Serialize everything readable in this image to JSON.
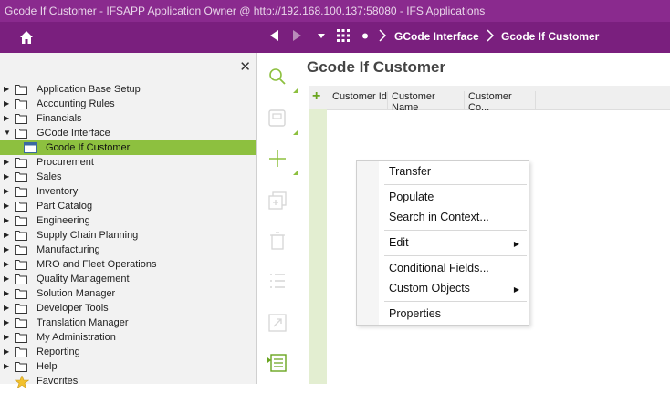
{
  "title_bar": {
    "text": "Gcode If Customer - IFSAPP Application Owner @ http://192.168.100.137:58080 - IFS Applications"
  },
  "nav": {
    "home_icon": "home-icon",
    "back_icon": "back-arrow-icon",
    "forward_icon": "forward-arrow-icon",
    "dropdown_icon": "chevron-down-icon",
    "apps_icon": "grid-icon",
    "dot_icon": "dot-icon",
    "breadcrumb": [
      "GCode Interface",
      "Gcode If Customer"
    ]
  },
  "sidebar": {
    "close_icon": "close-icon",
    "items": [
      {
        "label": "Application Base Setup"
      },
      {
        "label": "Accounting Rules"
      },
      {
        "label": "Financials"
      },
      {
        "label": "GCode Interface"
      },
      {
        "label": "Gcode If Customer"
      },
      {
        "label": "Procurement"
      },
      {
        "label": "Sales"
      },
      {
        "label": "Inventory"
      },
      {
        "label": "Part Catalog"
      },
      {
        "label": "Engineering"
      },
      {
        "label": "Supply Chain Planning"
      },
      {
        "label": "Manufacturing"
      },
      {
        "label": "MRO and Fleet Operations"
      },
      {
        "label": "Quality Management"
      },
      {
        "label": "Solution Manager"
      },
      {
        "label": "Developer Tools"
      },
      {
        "label": "Translation Manager"
      },
      {
        "label": "My Administration"
      },
      {
        "label": "Reporting"
      },
      {
        "label": "Help"
      },
      {
        "label": "Favorites"
      }
    ]
  },
  "toolbar": {
    "icons": [
      "search-icon",
      "save-icon",
      "add-icon",
      "duplicate-icon",
      "delete-icon",
      "list-icon",
      "open-icon",
      "details-icon"
    ]
  },
  "main": {
    "title": "Gcode If Customer",
    "columns": [
      "Customer Id",
      "Customer Name",
      "Customer Co..."
    ]
  },
  "context_menu": {
    "items": {
      "transfer": "Transfer",
      "populate": "Populate",
      "search_in_context": "Search in Context...",
      "edit": "Edit",
      "conditional_fields": "Conditional Fields...",
      "custom_objects": "Custom Objects",
      "properties": "Properties"
    }
  },
  "colors": {
    "title_bar": "#8a2a8e",
    "nav_bar": "#7a1f7e",
    "accent_green": "#8dc03f"
  }
}
